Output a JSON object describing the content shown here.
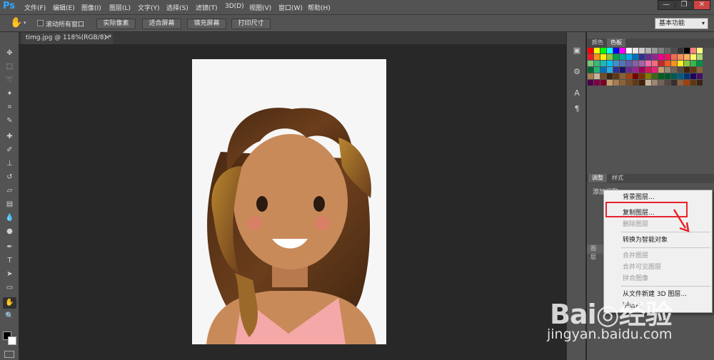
{
  "app": {
    "logo": "Ps"
  },
  "menu": [
    "文件(F)",
    "编辑(E)",
    "图像(I)",
    "图层(L)",
    "文字(Y)",
    "选择(S)",
    "滤镜(T)",
    "3D(D)",
    "视图(V)",
    "窗口(W)",
    "帮助(H)"
  ],
  "window_controls": {
    "minimize": "—",
    "restore": "❐",
    "close": "✕"
  },
  "options_bar": {
    "scroll_all_label": "滚动所有窗口",
    "buttons": [
      "实际像素",
      "适合屏幕",
      "填充屏幕",
      "打印尺寸"
    ],
    "workspace": "基本功能"
  },
  "document": {
    "tab_title": "timg.jpg @ 118%(RGB/8) *",
    "close": "×"
  },
  "panels": {
    "color_tabs": [
      "颜色",
      "色板"
    ],
    "adjust_tabs": [
      "调整",
      "样式"
    ],
    "adjust_hint": "添加调整",
    "layers_tab": "图层"
  },
  "context_menu": {
    "items": [
      {
        "label": "背景图层...",
        "disabled": false
      },
      {
        "label": "复制图层...",
        "disabled": false
      },
      {
        "label": "删除图层",
        "disabled": true
      },
      {
        "label": "转换为智能对象",
        "disabled": false
      },
      {
        "label": "合并图层",
        "disabled": true
      },
      {
        "label": "合并可见图层",
        "disabled": true
      },
      {
        "label": "拼合图像",
        "disabled": true
      },
      {
        "label": "从文件新建 3D 图层...",
        "disabled": false
      },
      {
        "label": "明信片",
        "disabled": false
      }
    ]
  },
  "watermark": {
    "logo": "Bai◎经验",
    "url": "jingyan.baidu.com"
  },
  "colors": {
    "highlight": "#e8222c",
    "ps_blue": "#31a8ff",
    "canvas_bg": "#f6f6f6"
  }
}
